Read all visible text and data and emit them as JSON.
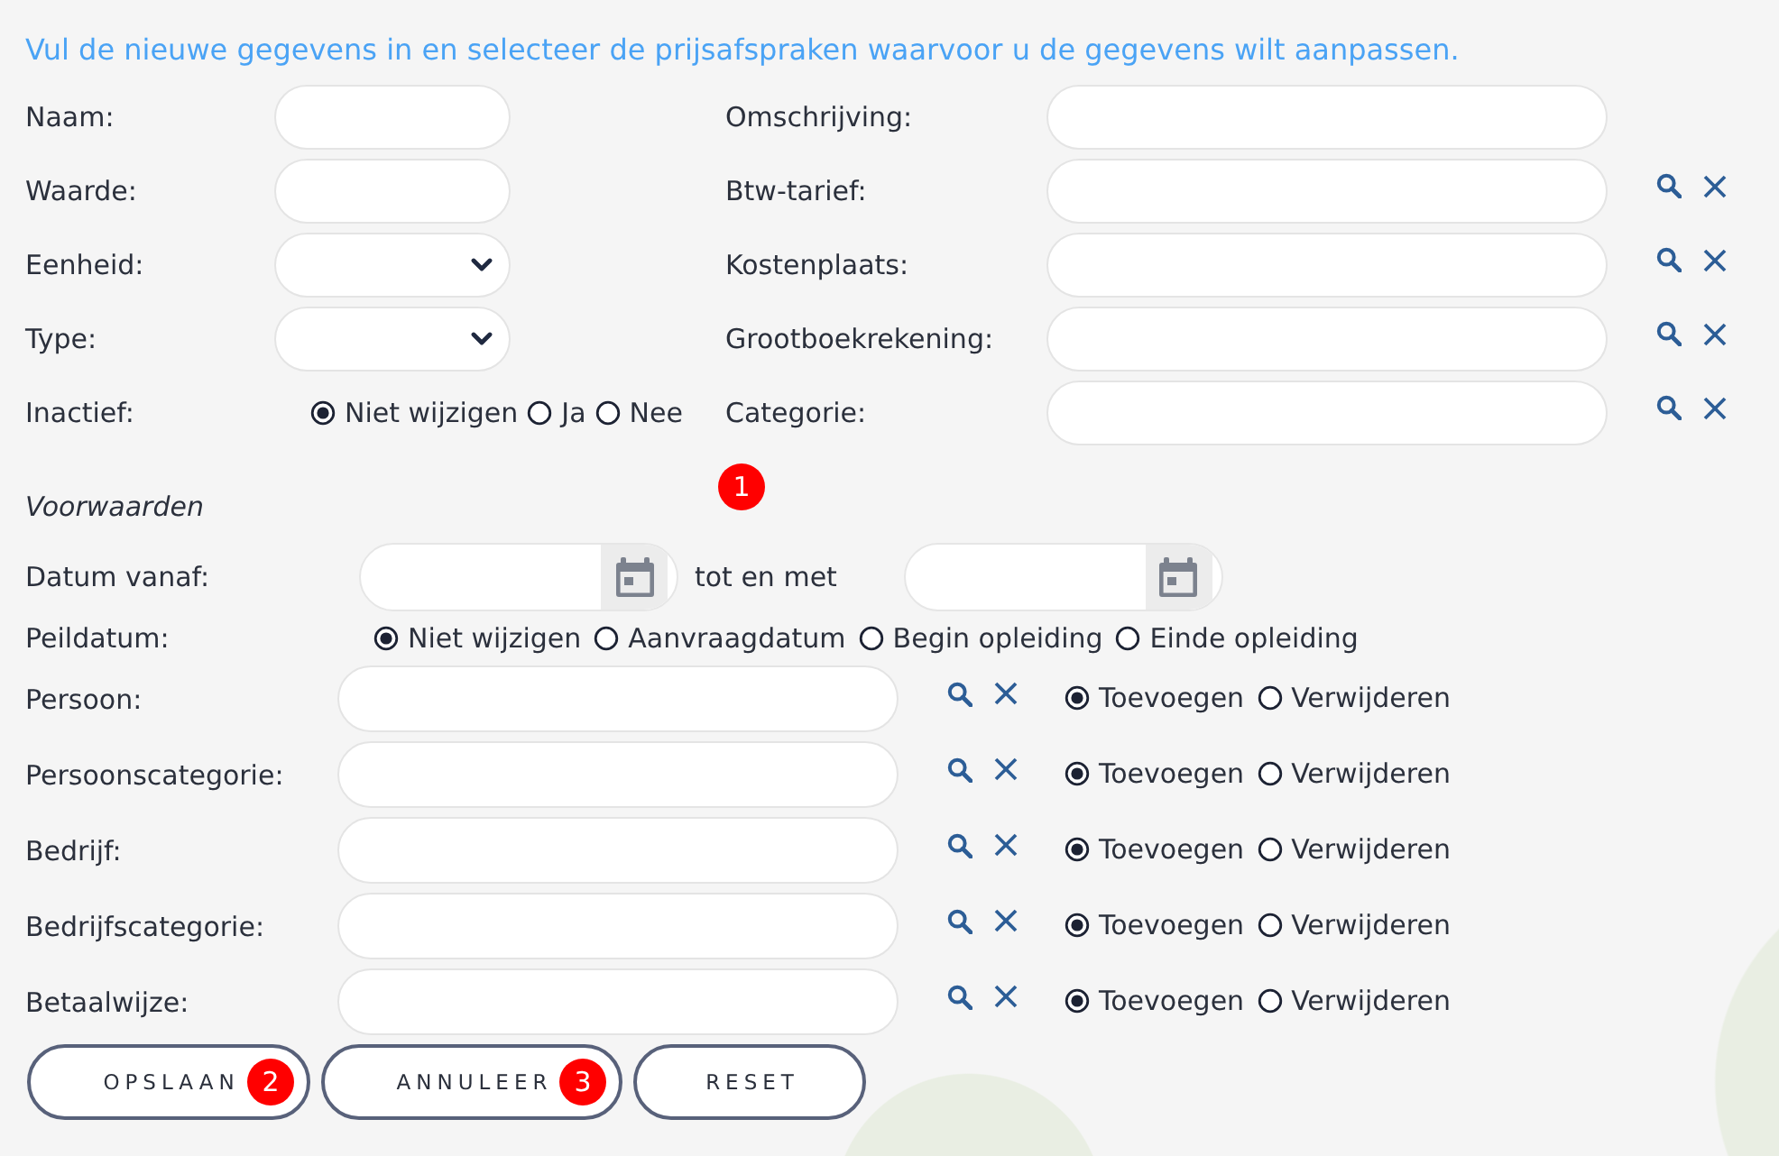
{
  "intro": "Vul de nieuwe gegevens in en selecteer de prijsafspraken waarvoor u de gegevens wilt aanpassen.",
  "general": {
    "left": [
      {
        "label": "Naam:",
        "kind": "text"
      },
      {
        "label": "Waarde:",
        "kind": "text"
      },
      {
        "label": "Eenheid:",
        "kind": "select"
      },
      {
        "label": "Type:",
        "kind": "select"
      },
      {
        "label": "Inactief:",
        "kind": "radio",
        "options": [
          {
            "label": "Niet wijzigen",
            "selected": true
          },
          {
            "label": "Ja",
            "selected": false
          },
          {
            "label": "Nee",
            "selected": false
          }
        ]
      }
    ],
    "right": [
      {
        "label": "Omschrijving:",
        "kind": "text"
      },
      {
        "label": "Btw-tarief:",
        "kind": "lookup"
      },
      {
        "label": "Kostenplaats:",
        "kind": "lookup"
      },
      {
        "label": "Grootboekrekening:",
        "kind": "lookup"
      },
      {
        "label": "Categorie:",
        "kind": "lookup"
      }
    ],
    "marker": "1"
  },
  "conditions": {
    "title": "Voorwaarden",
    "date_range": {
      "label": "Datum vanaf:",
      "separator": "tot en met"
    },
    "reference_date": {
      "label": "Peildatum:",
      "options": [
        {
          "label": "Niet wijzigen",
          "selected": true
        },
        {
          "label": "Aanvraagdatum",
          "selected": false
        },
        {
          "label": "Begin opleiding",
          "selected": false
        },
        {
          "label": "Einde opleiding",
          "selected": false
        }
      ]
    },
    "rows": [
      {
        "label": "Persoon:",
        "options": [
          {
            "label": "Toevoegen",
            "selected": true
          },
          {
            "label": "Verwijderen",
            "selected": false
          }
        ]
      },
      {
        "label": "Persoonscategorie:",
        "options": [
          {
            "label": "Toevoegen",
            "selected": true
          },
          {
            "label": "Verwijderen",
            "selected": false
          }
        ]
      },
      {
        "label": "Bedrijf:",
        "options": [
          {
            "label": "Toevoegen",
            "selected": true
          },
          {
            "label": "Verwijderen",
            "selected": false
          }
        ]
      },
      {
        "label": "Bedrijfscategorie:",
        "options": [
          {
            "label": "Toevoegen",
            "selected": true
          },
          {
            "label": "Verwijderen",
            "selected": false
          }
        ]
      },
      {
        "label": "Betaalwijze:",
        "options": [
          {
            "label": "Toevoegen",
            "selected": true
          },
          {
            "label": "Verwijderen",
            "selected": false
          }
        ]
      }
    ]
  },
  "buttons": [
    {
      "label": "OPSLAAN",
      "marker": "2"
    },
    {
      "label": "ANNULEER",
      "marker": "3"
    },
    {
      "label": "RESET"
    }
  ]
}
